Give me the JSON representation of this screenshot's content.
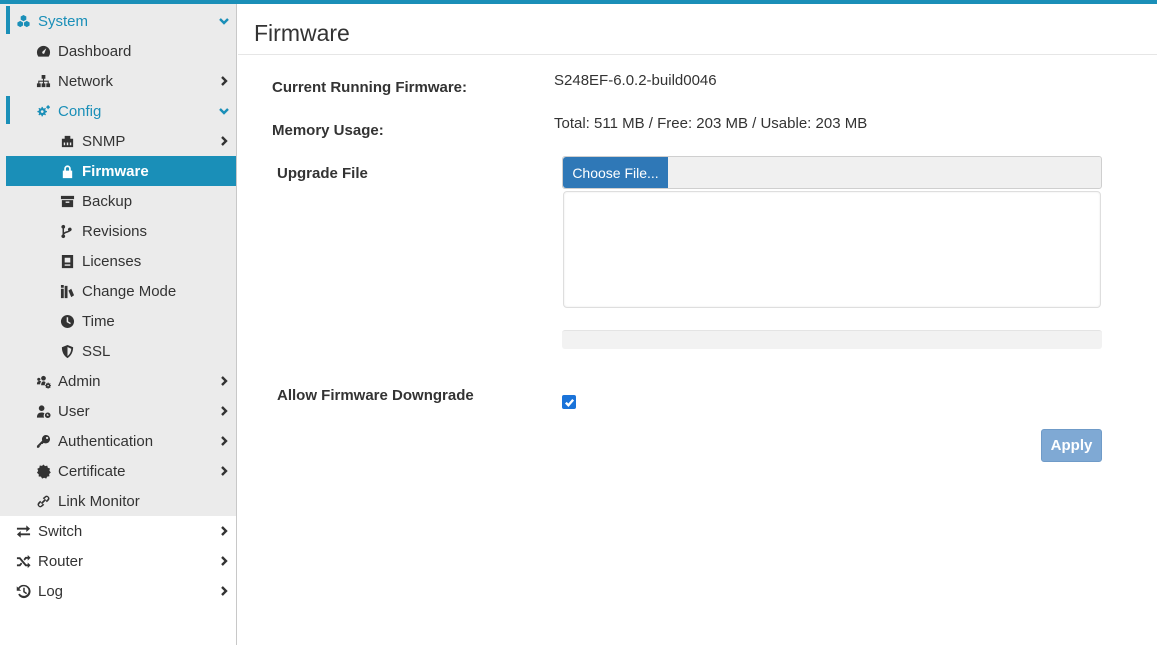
{
  "sidebar": {
    "system": "System",
    "dashboard": "Dashboard",
    "network": "Network",
    "config": "Config",
    "snmp": "SNMP",
    "firmware": "Firmware",
    "backup": "Backup",
    "revisions": "Revisions",
    "licenses": "Licenses",
    "change_mode": "Change Mode",
    "time": "Time",
    "ssl": "SSL",
    "admin": "Admin",
    "user": "User",
    "authentication": "Authentication",
    "certificate": "Certificate",
    "link_monitor": "Link Monitor",
    "switch": "Switch",
    "router": "Router",
    "log": "Log"
  },
  "main": {
    "title": "Firmware",
    "current_firmware_label": "Current Running Firmware:",
    "current_firmware_value": "S248EF-6.0.2-build0046",
    "memory_label": "Memory Usage:",
    "memory_value": "Total: 511 MB / Free: 203 MB / Usable: 203 MB",
    "upgrade_label": "Upgrade File",
    "choose_file_label": "Choose File...",
    "upload_progress": 0,
    "downgrade_label": "Allow Firmware Downgrade",
    "downgrade_checked": true,
    "apply_label": "Apply"
  },
  "colors": {
    "accent": "#1a8fb8",
    "primary_button": "#2f78b7",
    "apply_disabled": "#7fa9d4",
    "checkbox": "#1a73d9"
  },
  "icons": {
    "system": "cubes-icon",
    "dashboard": "tachometer-icon",
    "network": "sitemap-icon",
    "config": "cogs-icon",
    "snmp": "ethernet-icon",
    "firmware": "lock-icon",
    "backup": "archive-icon",
    "revisions": "code-branch-icon",
    "licenses": "book-icon",
    "change_mode": "mode-icon",
    "time": "clock-icon",
    "ssl": "shield-icon",
    "admin": "users-cog-icon",
    "user": "user-icon",
    "authentication": "key-icon",
    "certificate": "certificate-icon",
    "link_monitor": "link-icon",
    "switch": "exchange-icon",
    "router": "random-icon",
    "log": "history-icon"
  }
}
